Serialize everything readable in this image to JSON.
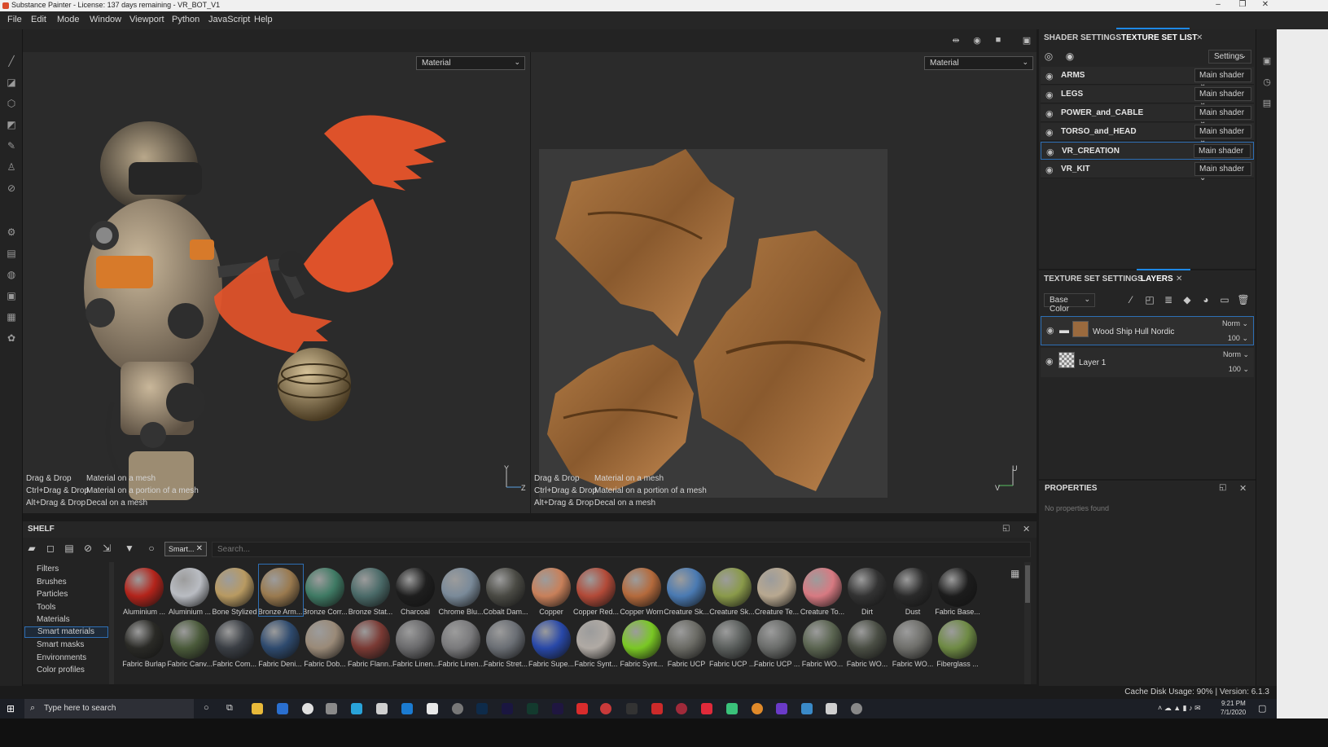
{
  "window": {
    "title": "Substance Painter - License: 137 days remaining - VR_BOT_V1",
    "controls": [
      "–",
      "❐",
      "✕"
    ]
  },
  "menu": [
    "File",
    "Edit",
    "Mode",
    "Window",
    "Viewport",
    "Python",
    "JavaScript",
    "Help"
  ],
  "viewport": {
    "left_dropdown": "Material",
    "right_dropdown": "Material",
    "hints_left": [
      {
        "key": "Drag & Drop",
        "desc": "Material on a mesh"
      },
      {
        "key": "Ctrl+Drag & Drop",
        "desc": "Material on a portion of a mesh"
      },
      {
        "key": "Alt+Drag & Drop",
        "desc": "Decal on a mesh"
      }
    ],
    "hints_right": [
      {
        "key": "Drag & Drop",
        "desc": "Material on a mesh"
      },
      {
        "key": "Ctrl+Drag & Drop",
        "desc": "Material on a portion of a mesh"
      },
      {
        "key": "Alt+Drag & Drop",
        "desc": "Decal on a mesh"
      }
    ],
    "axis_left": {
      "y": "Y",
      "z": "Z"
    },
    "axis_right": {
      "v": "V",
      "u": "U"
    }
  },
  "texture_set_list": {
    "tab_shader": "SHADER SETTINGS",
    "tab_list": "TEXTURE SET LIST",
    "settings_label": "Settings",
    "rows": [
      {
        "name": "ARMS",
        "shader": "Main shader"
      },
      {
        "name": "LEGS",
        "shader": "Main shader"
      },
      {
        "name": "POWER_and_CABLE",
        "shader": "Main shader"
      },
      {
        "name": "TORSO_and_HEAD",
        "shader": "Main shader"
      },
      {
        "name": "VR_CREATION",
        "shader": "Main shader",
        "selected": true
      },
      {
        "name": "VR_KIT",
        "shader": "Main shader"
      }
    ]
  },
  "layers": {
    "tab_settings": "TEXTURE SET SETTINGS",
    "tab_layers": "LAYERS",
    "channel": "Base Color",
    "items": [
      {
        "name": "Wood Ship Hull Nordic",
        "blend": "Norm",
        "opacity": "100"
      },
      {
        "name": "Layer 1",
        "blend": "Norm",
        "opacity": "100"
      }
    ]
  },
  "properties": {
    "title": "PROPERTIES",
    "empty": "No properties found"
  },
  "shelf": {
    "title": "SHELF",
    "filter_tag": "Smart...",
    "search_placeholder": "Search...",
    "categories": [
      "Filters",
      "Brushes",
      "Particles",
      "Tools",
      "Materials",
      "Smart materials",
      "Smart masks",
      "Environments",
      "Color profiles"
    ],
    "selected_category": "Smart materials",
    "row1": [
      {
        "label": "Aluminium ...",
        "color": "#b3241b"
      },
      {
        "label": "Aluminium ...",
        "color": "#b9bcc2"
      },
      {
        "label": "Bone Stylized",
        "color": "#b89a62"
      },
      {
        "label": "Bronze Arm...",
        "color": "#9a7a4f"
      },
      {
        "label": "Bronze Corr...",
        "color": "#3f7a64"
      },
      {
        "label": "Bronze Stat...",
        "color": "#4a6a68"
      },
      {
        "label": "Charcoal",
        "color": "#1e1e1e"
      },
      {
        "label": "Chrome Blu...",
        "color": "#7a8a99"
      },
      {
        "label": "Cobalt Dam...",
        "color": "#4a4a44"
      },
      {
        "label": "Copper",
        "color": "#c8805a"
      },
      {
        "label": "Copper Red...",
        "color": "#b24a38"
      },
      {
        "label": "Copper Worn",
        "color": "#b46a3c"
      },
      {
        "label": "Creature Sk...",
        "color": "#4a7ab2"
      },
      {
        "label": "Creature Sk...",
        "color": "#8a9a4a"
      },
      {
        "label": "Creature Te...",
        "color": "#b8a890"
      },
      {
        "label": "Creature To...",
        "color": "#d77a82"
      },
      {
        "label": "Dirt",
        "color": "#333333"
      },
      {
        "label": "Dust",
        "color": "#2a2a2a"
      },
      {
        "label": "Fabric Base...",
        "color": "#1c1c1c"
      }
    ],
    "row2": [
      {
        "label": "Fabric Burlap",
        "color": "#2a2a26"
      },
      {
        "label": "Fabric Canv...",
        "color": "#4a5a3a"
      },
      {
        "label": "Fabric Com...",
        "color": "#3a3e44"
      },
      {
        "label": "Fabric Deni...",
        "color": "#2e4a6e"
      },
      {
        "label": "Fabric Dob...",
        "color": "#9a8a78"
      },
      {
        "label": "Fabric Flann...",
        "color": "#7a3a34"
      },
      {
        "label": "Fabric Linen...",
        "color": "#6a6a6c"
      },
      {
        "label": "Fabric Linen...",
        "color": "#7a7a7c"
      },
      {
        "label": "Fabric Stret...",
        "color": "#6a6e74"
      },
      {
        "label": "Fabric Supe...",
        "color": "#2848a8"
      },
      {
        "label": "Fabric Synt...",
        "color": "#b0aaa4"
      },
      {
        "label": "Fabric Synt...",
        "color": "#7ac824"
      },
      {
        "label": "Fabric UCP",
        "color": "#6a6a64"
      },
      {
        "label": "Fabric UCP ...",
        "color": "#5a5e5c"
      },
      {
        "label": "Fabric UCP ...",
        "color": "#6a6c6a"
      },
      {
        "label": "Fabric WO...",
        "color": "#5a6450"
      },
      {
        "label": "Fabric WO...",
        "color": "#4a4e44"
      },
      {
        "label": "Fabric WO...",
        "color": "#6e6e6a"
      },
      {
        "label": "Fiberglass ...",
        "color": "#6e8a44"
      }
    ]
  },
  "status": {
    "text": "Cache Disk Usage: 90% | Version: 6.1.3"
  },
  "taskbar": {
    "search_placeholder": "Type here to search",
    "time": "9:21 PM",
    "date": "7/1/2020"
  }
}
